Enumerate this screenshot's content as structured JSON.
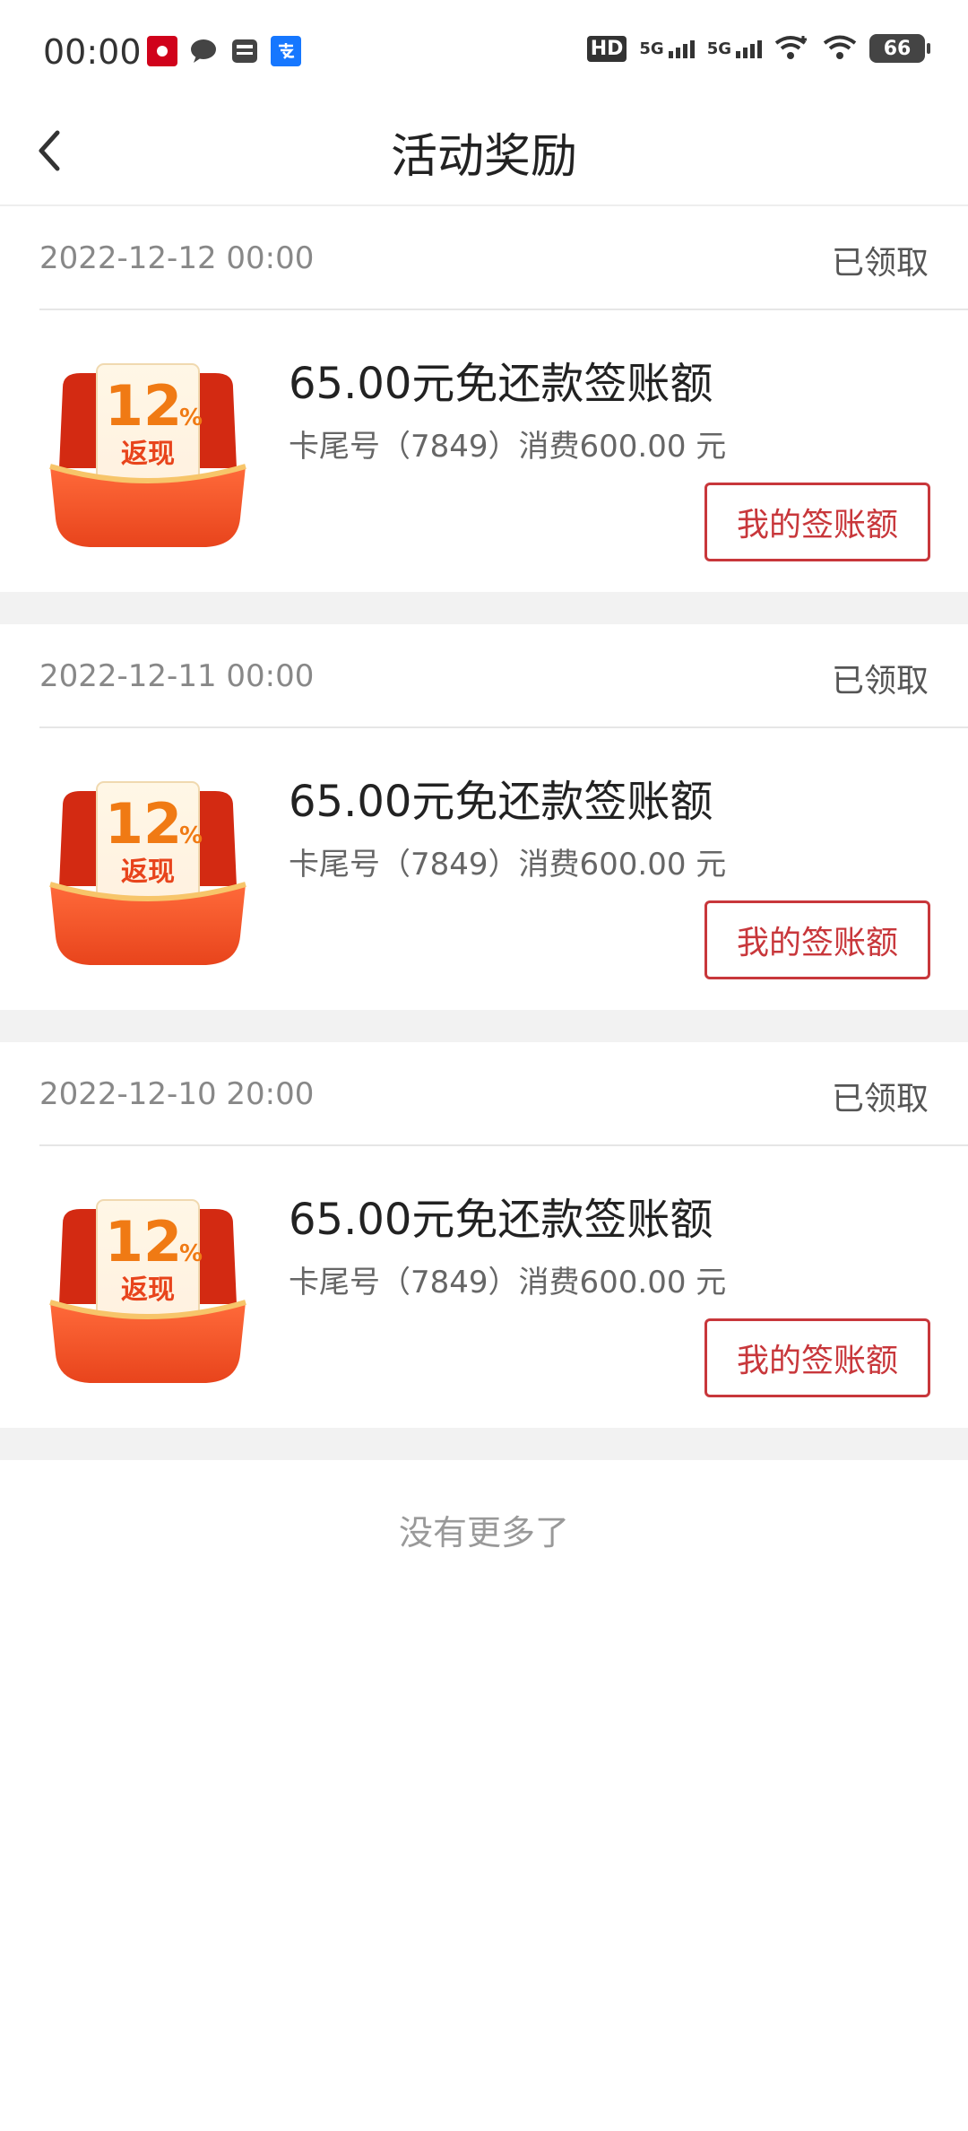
{
  "status_bar": {
    "time": "00:00",
    "battery": "66",
    "network_1": "5G",
    "network_2": "5G",
    "hd_label": "HD"
  },
  "nav": {
    "title": "活动奖励",
    "back_icon": "chevron-left-icon"
  },
  "rewards": [
    {
      "date": "2022-12-12 00:00",
      "status": "已领取",
      "amount": "65.00元免还款签账额",
      "description": "卡尾号（7849）消费600.00 元",
      "button": "我的签账额",
      "badge_percent": "12",
      "badge_unit": "%",
      "badge_label": "返现"
    },
    {
      "date": "2022-12-11 00:00",
      "status": "已领取",
      "amount": "65.00元免还款签账额",
      "description": "卡尾号（7849）消费600.00 元",
      "button": "我的签账额",
      "badge_percent": "12",
      "badge_unit": "%",
      "badge_label": "返现"
    },
    {
      "date": "2022-12-10 20:00",
      "status": "已领取",
      "amount": "65.00元免还款签账额",
      "description": "卡尾号（7849）消费600.00 元",
      "button": "我的签账额",
      "badge_percent": "12",
      "badge_unit": "%",
      "badge_label": "返现"
    }
  ],
  "footer_text": "没有更多了",
  "colors": {
    "accent": "#c8373b",
    "badge_orange": "#f05a28",
    "page_gap": "#f2f2f2"
  }
}
